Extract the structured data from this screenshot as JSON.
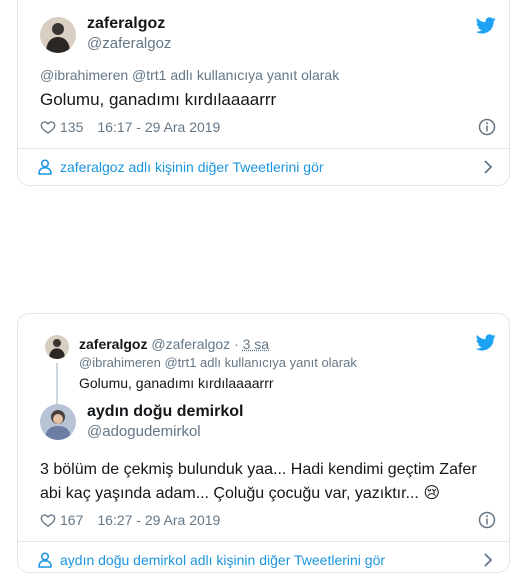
{
  "tweet1": {
    "display_name": "zaferalgoz",
    "handle": "@zaferalgoz",
    "reply_context": "@ibrahimeren @trt1 adlı kullanıcıya yanıt olarak",
    "text": "Golumu, ganadımı kırdılaaaarrr",
    "likes": "135",
    "timestamp": "16:17 - 29 Ara 2019",
    "more_tweets": "zaferalgoz adlı kişinin diğer Tweetlerini gör"
  },
  "tweet2": {
    "quoted": {
      "display_name": "zaferalgoz",
      "handle": "@zaferalgoz",
      "separator": "·",
      "age": "3 sa",
      "reply_context": "@ibrahimeren @trt1 adlı kullanıcıya yanıt olarak",
      "text": "Golumu, ganadımı kırdılaaaarrr"
    },
    "display_name": "aydın doğu demirkol",
    "handle": "@adogudemirkol",
    "text_line1": "3 bölüm de çekmiş bulunduk yaa... Hadi kendimi geçtim Zafer",
    "text_line2": "abi kaç yaşında adam... Çoluğu çocuğu var, yazıktır...",
    "emoji": "😢",
    "likes": "167",
    "timestamp": "16:27 - 29 Ara 2019",
    "more_tweets": "aydın doğu demirkol adlı kişinin diğer Tweetlerini gör"
  },
  "colors": {
    "accent": "#1da1f2",
    "link": "#1b95e0",
    "muted": "#657786",
    "border": "#e1e8ed",
    "text": "#14171a"
  },
  "icons": [
    "twitter-bird-icon",
    "heart-icon",
    "info-icon",
    "person-icon",
    "chevron-right-icon"
  ]
}
